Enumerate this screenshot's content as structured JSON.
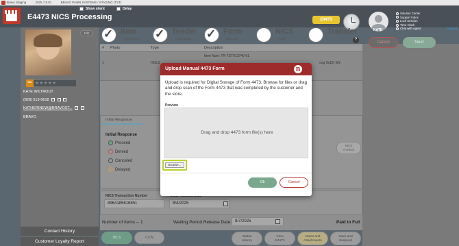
{
  "window": {
    "title": "Bravo Staging",
    "version": "2025.7.8.81",
    "company": "BRAVO PAWN SYSTEMS / STAGING (TST)"
  },
  "header": {
    "app_title": "E4473 NICS Processing",
    "show_silent_label": "Show silent",
    "delay_label": "Delay",
    "brand_pill": "E4473",
    "user_name": "KATE",
    "user_menu": [
      "Solution Center",
      "Support Inbox",
      "Lock Session",
      "Time Clock",
      "Chat with Agent"
    ],
    "staging_label": "Staging",
    "cancel_label": "Cancel",
    "next_label": "Next"
  },
  "steps": [
    {
      "title": "Item",
      "sub": "Completed",
      "done": true
    },
    {
      "title": "Tender",
      "sub": "Completed",
      "done": true
    },
    {
      "title": "Form",
      "sub": "Manual",
      "done": true
    },
    {
      "title": "NICS",
      "sub": "Start",
      "done": false
    },
    {
      "title": "Transfer",
      "sub": "",
      "done": false
    }
  ],
  "customer": {
    "edit_label": "Edit",
    "rating_badge": "NO",
    "stars": "★★★★★",
    "name": "KATE WILTROUT",
    "phone": "(828) 513-0618",
    "email": "KATHERINEW@BRAVOST...",
    "company": "BRAVO",
    "contact_history_label": "Contact History",
    "loyalty_report_label": "Customer Loyalty Report"
  },
  "table": {
    "columns": [
      "#",
      "Photo",
      "Type",
      "Description"
    ],
    "rows": [
      {
        "num": "1",
        "type": "HGLS",
        "desc1": "Item Num: TR-TST013740-01",
        "desc2": "ong 9x19) SN"
      }
    ]
  },
  "initial_response": {
    "tab_label": "Initial Response",
    "title": "Initial Response",
    "options": [
      "Proceed",
      "Denied",
      "Canceled",
      "Delayed"
    ],
    "option_colors": [
      "#6aa67e",
      "#c0504d",
      "#4a4a4a",
      "#d49a3a"
    ],
    "nics_echeck_label1": "NICS",
    "nics_echeck_label2": "e-check"
  },
  "transaction": {
    "nics_txn_label": "NICS Transaction Number",
    "nics_txn_value": "8964185616851",
    "nics_transmit_label": "NICS Transmit Date",
    "nics_transmit_value": "8/4/2025"
  },
  "footer": {
    "items_label": "Number of Items -- 1",
    "waiting_label": "Waiting Period Release Date:",
    "waiting_date": "8/7/2025",
    "paid_label": "Paid in Full",
    "pill_nics": "NICS",
    "pill_ccw": "CCW",
    "btn_status": [
      "Status",
      "History"
    ],
    "btn_view": [
      "View",
      "E4473"
    ],
    "btn_notes": [
      "Notes and",
      "Attachments"
    ],
    "btn_save": [
      "Save and",
      "Suspend"
    ]
  },
  "modal": {
    "title": "Upload Manual 4473 Form",
    "logo": "B",
    "body": "Upload is required for Digital Storage of Form 4473. Browse for files or drag and drop scan of the Form 4473 that was completed by the customer and the store.",
    "preview_label": "Preview",
    "drop_text": "Drag and drop 4473 form file(s) here",
    "browse_label": "Browse...",
    "ok_label": "Ok",
    "cancel_label": "Cancel"
  }
}
